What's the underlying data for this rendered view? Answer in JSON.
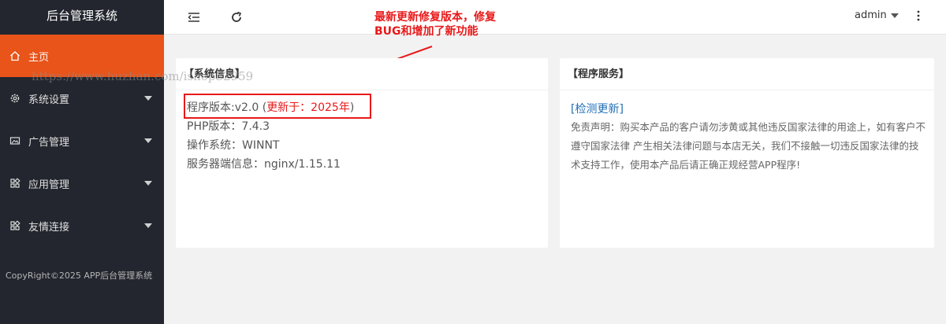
{
  "sidebar": {
    "brand": "后台管理系统",
    "items": [
      {
        "label": "主页",
        "icon": "home-icon"
      },
      {
        "label": "系统设置",
        "icon": "gear-icon"
      },
      {
        "label": "广告管理",
        "icon": "image-icon"
      },
      {
        "label": "应用管理",
        "icon": "apps-icon"
      },
      {
        "label": "友情连接",
        "icon": "apps-icon"
      }
    ],
    "copyright": "CopyRight©2025 APP后台管理系统"
  },
  "header": {
    "user": "admin",
    "icons": [
      "menu-fold-icon",
      "refresh-icon",
      "more-vertical-icon"
    ]
  },
  "annotation": {
    "line1": "最新更新修复版本，修复",
    "line2": "BUG和增加了新功能"
  },
  "watermark": "https://www.huzhan.com/ishop32959",
  "system_info": {
    "title": "【系统信息】",
    "version_label": "程序版本:v2.0 (",
    "version_update": "更新于：2025年",
    "version_close": ")",
    "php": "PHP版本：7.4.3",
    "os": "操作系统：WINNT",
    "server": "服务器端信息：nginx/1.15.11"
  },
  "service": {
    "title": "【程序服务】",
    "check_update": "[检测更新]",
    "disclaimer": "免责声明：购买本产品的客户请勿涉黄或其他违反国家法律的用途上，如有客户不遵守国家法律 产生相关法律问题与本店无关，我们不接触一切违反国家法律的技术支持工作，使用本产品后请正确正规经营APP程序!"
  },
  "colors": {
    "sidebar_bg": "#23262e",
    "active": "#e8541a",
    "annotation": "#e8191a",
    "link": "#1e6fb5"
  }
}
